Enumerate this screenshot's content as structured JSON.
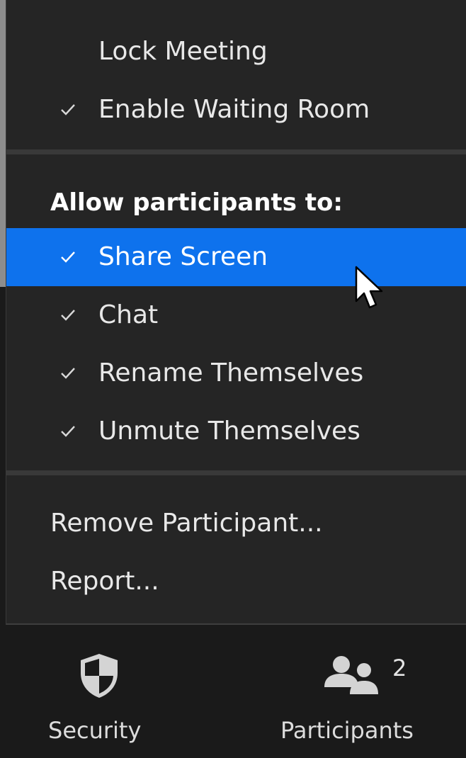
{
  "menu": {
    "lock_meeting": {
      "label": "Lock Meeting",
      "checked": false
    },
    "waiting_room": {
      "label": "Enable Waiting Room",
      "checked": true
    },
    "allow_heading": "Allow participants to:",
    "permissions": [
      {
        "label": "Share Screen",
        "checked": true,
        "highlighted": true
      },
      {
        "label": "Chat",
        "checked": true,
        "highlighted": false
      },
      {
        "label": "Rename Themselves",
        "checked": true,
        "highlighted": false
      },
      {
        "label": "Unmute Themselves",
        "checked": true,
        "highlighted": false
      }
    ],
    "remove_participant": "Remove Participant...",
    "report": "Report..."
  },
  "toolbar": {
    "security": {
      "label": "Security",
      "icon": "shield-icon"
    },
    "participants": {
      "label": "Participants",
      "icon": "participants-icon",
      "count": "2"
    }
  },
  "colors": {
    "menu_bg": "#252525",
    "highlight": "#0e72ed",
    "toolbar_bg": "#1a1a1a"
  }
}
